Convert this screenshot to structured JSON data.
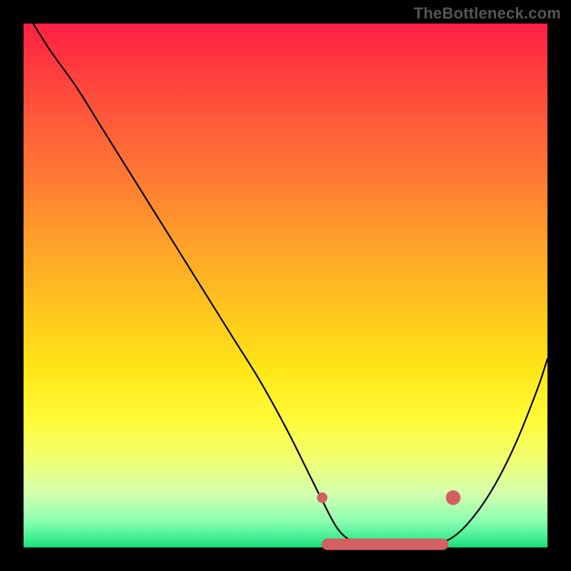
{
  "watermark": "TheBottleneck.com",
  "chart_data": {
    "type": "line",
    "title": "",
    "xlabel": "",
    "ylabel": "",
    "xlim": [
      0,
      100
    ],
    "ylim": [
      0,
      100
    ],
    "series": [
      {
        "name": "bottleneck-curve",
        "x": [
          0,
          5,
          10,
          15,
          20,
          25,
          30,
          35,
          40,
          45,
          50,
          55,
          57,
          60,
          63,
          66,
          70,
          74,
          78,
          82,
          86,
          90,
          94,
          98,
          100
        ],
        "y": [
          103,
          95,
          88,
          80,
          72,
          64,
          56,
          48,
          40,
          32,
          23,
          13,
          9,
          3.5,
          1,
          0,
          0,
          0,
          0.5,
          2,
          6,
          12,
          20,
          30,
          36
        ]
      }
    ],
    "markers": [
      {
        "name": "optimal-start",
        "x": 57,
        "y": 9.5,
        "color": "#d36060",
        "r": 1.0
      },
      {
        "name": "optimal-end",
        "x": 82,
        "y": 9.5,
        "color": "#d36060",
        "r": 1.4
      }
    ],
    "optimal_band": {
      "color": "#d36060",
      "thickness": 2.2,
      "y": 0.6,
      "x_start": 58,
      "x_end": 80
    },
    "colors": {
      "curve": "#000000",
      "background_top": "#ff1f44",
      "background_bottom": "#19d977"
    }
  }
}
